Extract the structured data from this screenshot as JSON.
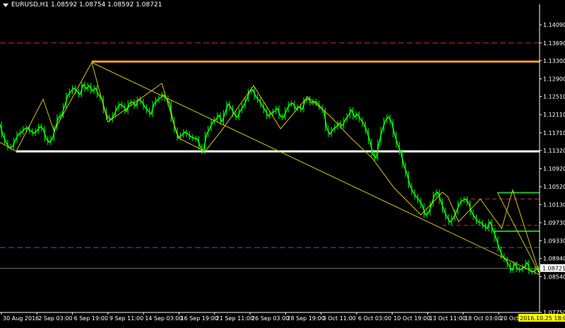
{
  "window": {
    "symbol_caption": "EURUSD,H1  1.08592 1.08754 1.08592 1.08721",
    "caret_icon": "triangle-down-icon"
  },
  "colors": {
    "background": "#000000",
    "price": "#00ff00",
    "axis": "#ffffff",
    "zigzag": "#d4c418",
    "resistance": "#f0a020",
    "support": "#ffffff",
    "dash_red": "#c03030",
    "dash_blue": "#5050c0",
    "box_green": "#20c020",
    "current_price_bg": "#ffffff",
    "time_marker_bg": "#ffff00"
  },
  "chart_data": {
    "type": "line",
    "symbol": "EURUSD",
    "timeframe": "H1",
    "ohlc": {
      "open": 1.08592,
      "high": 1.08754,
      "low": 1.08592,
      "close": 1.08721
    },
    "ylim": [
      1.0775,
      1.1445
    ],
    "y_ticks": [
      "1.14090",
      "1.13690",
      "1.13300",
      "1.12900",
      "1.12510",
      "1.12110",
      "1.11710",
      "1.11320",
      "1.10920",
      "1.10520",
      "1.10130",
      "1.09730",
      "1.09330",
      "1.08940",
      "1.08540",
      "1.07750"
    ],
    "current_price_label": "1.08721",
    "current_price": 1.08721,
    "x_ticks": [
      "30 Aug 2016",
      "2 Sep 03:00",
      "6 Sep 19:00",
      "9 Sep 11:00",
      "14 Sep 03:00",
      "16 Sep 19:00",
      "21 Sep 11:00",
      "26 Sep 03:00",
      "28 Sep 19:00",
      "3 Oct 11:00",
      "6 Oct 03:00",
      "10 Oct 19:00",
      "13 Oct 11:00",
      "18 Oct 03:00",
      "20 Oct 19:00"
    ],
    "time_marker_label": "2016.10.25 18:00",
    "series": [
      {
        "values": [
          1.119,
          1.1165,
          1.115,
          1.1138,
          1.114,
          1.1155,
          1.1168,
          1.1172,
          1.118,
          1.1182,
          1.1175,
          1.117,
          1.1175,
          1.1185,
          1.118,
          1.1158,
          1.115,
          1.1158,
          1.1182,
          1.1205,
          1.121,
          1.123,
          1.1254,
          1.1262,
          1.127,
          1.1262,
          1.1255,
          1.1278,
          1.1268,
          1.1275,
          1.1263,
          1.127,
          1.1254,
          1.1247,
          1.122,
          1.1205,
          1.12,
          1.121,
          1.1225,
          1.1234,
          1.123,
          1.1218,
          1.1236,
          1.1239,
          1.123,
          1.1245,
          1.124,
          1.1228,
          1.122,
          1.1212,
          1.1235,
          1.1243,
          1.1248,
          1.1255,
          1.1247,
          1.1236,
          1.12,
          1.1177,
          1.116,
          1.1166,
          1.1173,
          1.1168,
          1.1162,
          1.1159,
          1.1158,
          1.114,
          1.113,
          1.1168,
          1.118,
          1.1195,
          1.12,
          1.121,
          1.1195,
          1.1215,
          1.1235,
          1.1226,
          1.1212,
          1.1205,
          1.122,
          1.123,
          1.1245,
          1.1262,
          1.1266,
          1.125,
          1.1243,
          1.1232,
          1.122,
          1.1208,
          1.1214,
          1.1218,
          1.1225,
          1.1207,
          1.1205,
          1.1222,
          1.1234,
          1.1236,
          1.1224,
          1.1228,
          1.1222,
          1.1243,
          1.1246,
          1.1237,
          1.124,
          1.1236,
          1.1227,
          1.122,
          1.118,
          1.1168,
          1.1178,
          1.1184,
          1.1192,
          1.1186,
          1.12,
          1.1209,
          1.1222,
          1.1206,
          1.1212,
          1.12,
          1.119,
          1.1175,
          1.1152,
          1.1123,
          1.1115,
          1.115,
          1.1178,
          1.1198,
          1.1206,
          1.1195,
          1.1167,
          1.1145,
          1.1128,
          1.11,
          1.108,
          1.1055,
          1.104,
          1.103,
          1.1022,
          1.101,
          1.099,
          1.0994,
          1.1014,
          1.1035,
          1.104,
          1.102,
          1.1,
          1.0985,
          1.0974,
          1.0983,
          1.0996,
          1.1015,
          1.1022,
          1.1025,
          1.1016,
          1.0995,
          1.0985,
          1.0975,
          1.0973,
          1.0966,
          1.096,
          1.0975,
          1.0955,
          1.0937,
          1.0915,
          1.0899,
          1.0892,
          1.088,
          1.0868,
          1.0882,
          1.087,
          1.0869,
          1.0875,
          1.0885,
          1.0866,
          1.0865,
          1.087,
          1.0872
        ]
      }
    ],
    "zigzag": {
      "points": [
        [
          0.0,
          1.115
        ],
        [
          0.03,
          1.113
        ],
        [
          0.08,
          1.1245
        ],
        [
          0.1,
          1.1175
        ],
        [
          0.17,
          1.1326
        ],
        [
          0.2,
          1.1195
        ],
        [
          0.3,
          1.128
        ],
        [
          0.33,
          1.116
        ],
        [
          0.38,
          1.113
        ],
        [
          0.41,
          1.1175
        ],
        [
          0.47,
          1.1275
        ],
        [
          0.52,
          1.118
        ],
        [
          0.57,
          1.125
        ],
        [
          0.61,
          1.121
        ],
        [
          0.65,
          1.116
        ],
        [
          0.69,
          1.1115
        ],
        [
          0.73,
          1.105
        ],
        [
          0.78,
          1.099
        ],
        [
          0.82,
          1.104
        ],
        [
          0.83,
          1.103
        ],
        [
          0.85,
          1.0975
        ],
        [
          0.89,
          1.1025
        ],
        [
          0.93,
          1.096
        ],
        [
          0.95,
          1.1045
        ],
        [
          1.0,
          1.086
        ]
      ],
      "trendline_from": [
        0.17,
        1.1326
      ],
      "trendline_to": [
        1.0,
        1.0858
      ]
    },
    "levels": [
      {
        "name": "resistance",
        "price": 1.1328,
        "style": "solid"
      },
      {
        "name": "support",
        "price": 1.113,
        "style": "solid"
      },
      {
        "name": "upper-dashed",
        "price": 1.1369,
        "style": "dashed"
      },
      {
        "name": "lower-dashed",
        "price": 1.0918,
        "style": "dashed"
      },
      {
        "name": "current",
        "price": 1.08721,
        "style": "thin"
      }
    ],
    "box": {
      "top": 1.1039,
      "bottom": 1.0954,
      "top_dashed": 1.1025,
      "bottom_dashed": 1.0967
    }
  }
}
